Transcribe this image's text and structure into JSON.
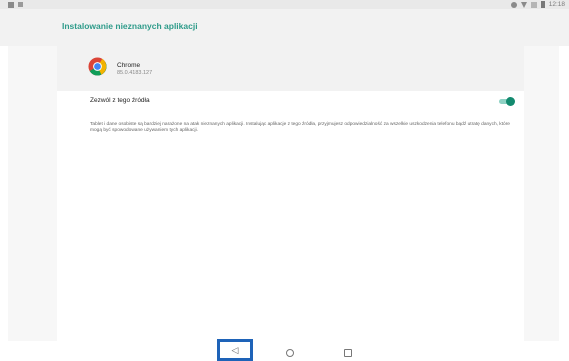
{
  "status_bar": {
    "time": "12:18",
    "left_icons": [
      "image-icon",
      "edit-icon"
    ],
    "right_icons": [
      "sync-icon",
      "wifi-icon",
      "no-signal-icon",
      "battery-icon"
    ]
  },
  "header": {
    "title": "Instalowanie nieznanych aplikacji",
    "accent_color": "#2e9b8a"
  },
  "app": {
    "name": "Chrome",
    "version": "85.0.4183.127",
    "icon": "chrome-icon"
  },
  "setting": {
    "label": "Zezwól z tego źródła",
    "enabled": true,
    "toggle_color": "#138a6f"
  },
  "warning": {
    "text": "Tablet i dane osobiste są bardziej narażone na atak nieznanych aplikacji. Instalując aplikacje z tego źródła, przyjmujesz odpowiedzialność za wszelkie uszkodzenia telefonu bądź utratę danych, które mogą być spowodowane używaniem tych aplikacji."
  },
  "navbar": {
    "back_icon": "◁",
    "home_icon": "home-circle-icon",
    "recent_icon": "recents-square-icon",
    "highlight_color": "#1e63b8"
  }
}
